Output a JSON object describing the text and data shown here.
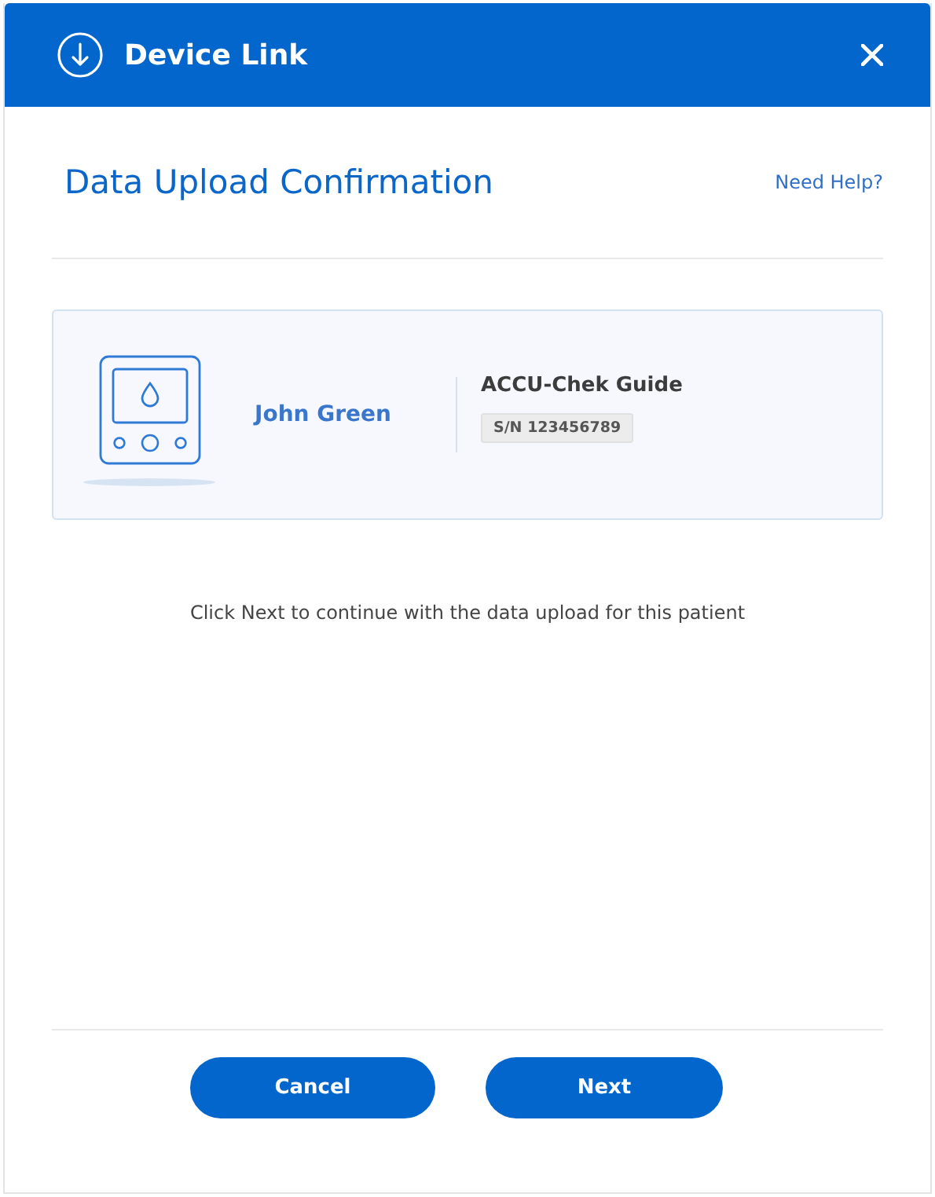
{
  "window": {
    "title": "Device Link"
  },
  "heading": "Data Upload Confirmation",
  "help_link": "Need Help?",
  "patient": {
    "name": "John Green"
  },
  "device": {
    "name": "ACCU-Chek Guide",
    "serial": "S/N 123456789"
  },
  "message": "Click Next to continue with the data upload for this patient",
  "buttons": [
    {
      "label": "Cancel"
    },
    {
      "label": "Next"
    }
  ]
}
